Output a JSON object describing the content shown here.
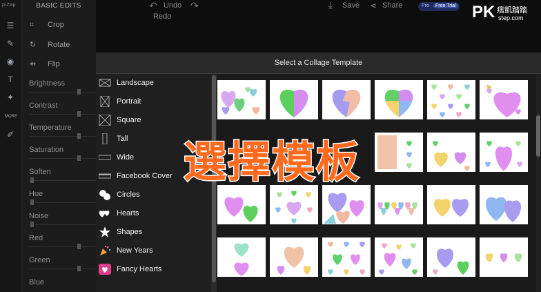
{
  "rail": {
    "logo": "piZap"
  },
  "panel": {
    "title": "BASIC EDITS",
    "tools": [
      "Crop",
      "Rotate",
      "Flip"
    ],
    "sliders": [
      "Brightness",
      "Contrast",
      "Temperature",
      "Saturation",
      "Soften",
      "Hue",
      "Noise",
      "Red",
      "Green",
      "Blue"
    ]
  },
  "topbar": {
    "undo": "Undo",
    "redo": "Redo",
    "save": "Save",
    "share": "Share",
    "pro_tag": "Pro",
    "trial_tag": "Free Trial",
    "pk_logo": "PK",
    "pk_site": "痞凱踏踏",
    "pk_url": "step.com"
  },
  "modal": {
    "title": "Select a Collage Template",
    "categories": [
      "Landscape",
      "Portrait",
      "Square",
      "Tall",
      "Wide",
      "Facebook Cover",
      "Circles",
      "Hearts",
      "Shapes",
      "New Years",
      "Fancy Hearts"
    ]
  },
  "caption": "選擇模板",
  "colors": {
    "accent": "#ff6a1f",
    "modal_header": "#2a2a2a",
    "panel": "#1c1c1c"
  }
}
